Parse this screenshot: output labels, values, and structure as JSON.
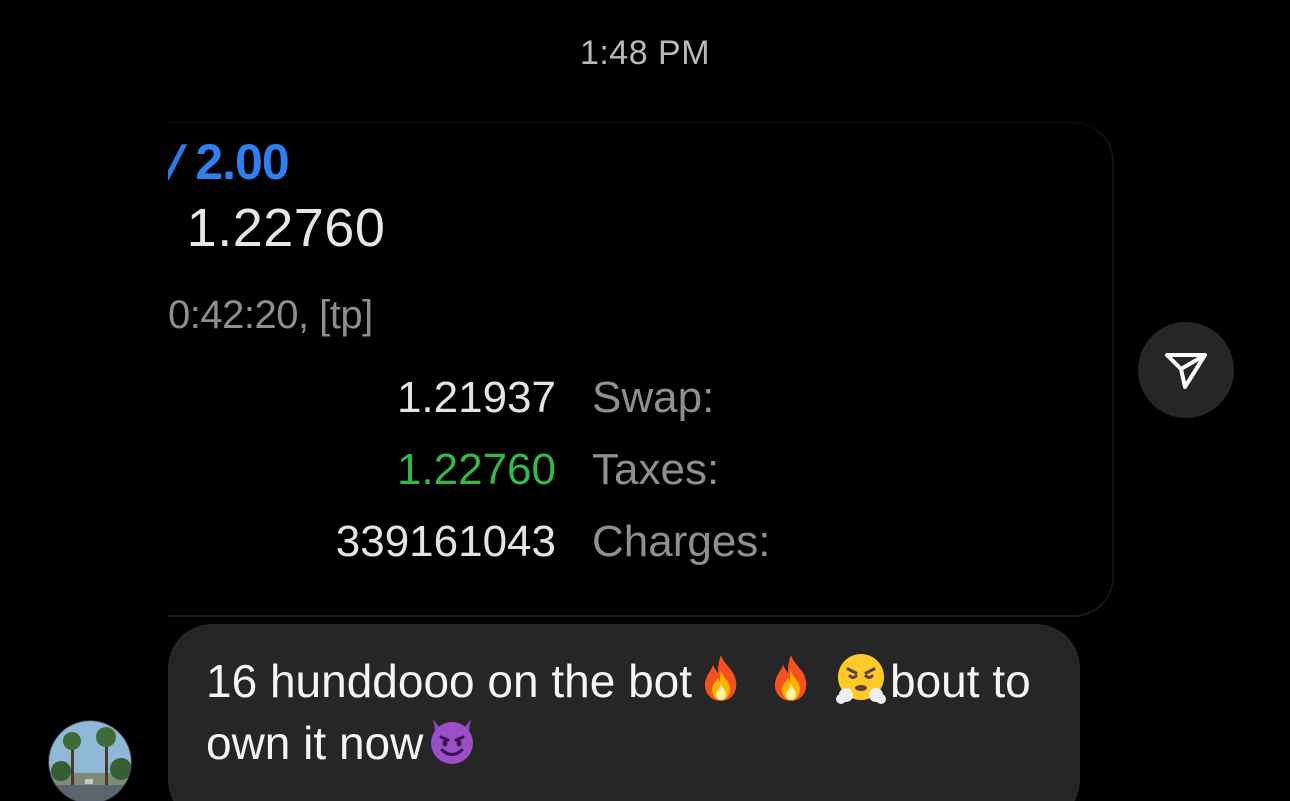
{
  "timestamp": "1:48 PM",
  "shared_image": {
    "volume_prefix": "/",
    "volume": "2.00",
    "price_prefix": "·",
    "price": "1.22760",
    "time_fragment": "0:42:20, [tp]",
    "rows": [
      {
        "value": "1.21937",
        "label": "Swap:"
      },
      {
        "value": "1.22760",
        "label": "Taxes:"
      },
      {
        "value": "339161043",
        "label": "Charges:"
      }
    ]
  },
  "message": {
    "text_part1": "16 hunddooo on the bot",
    "text_part2": "bout to own it now",
    "emoji": [
      "fire-emoji",
      "fire-emoji",
      "steam-from-nose-emoji",
      "smiling-devil-emoji"
    ]
  },
  "share_button": {
    "icon": "send-icon"
  },
  "avatar": {
    "icon": "palm-trees-photo"
  },
  "colors": {
    "background": "#000000",
    "bubble": "#262626",
    "accent_blue": "#2f7fee",
    "accent_green": "#34b84a"
  }
}
